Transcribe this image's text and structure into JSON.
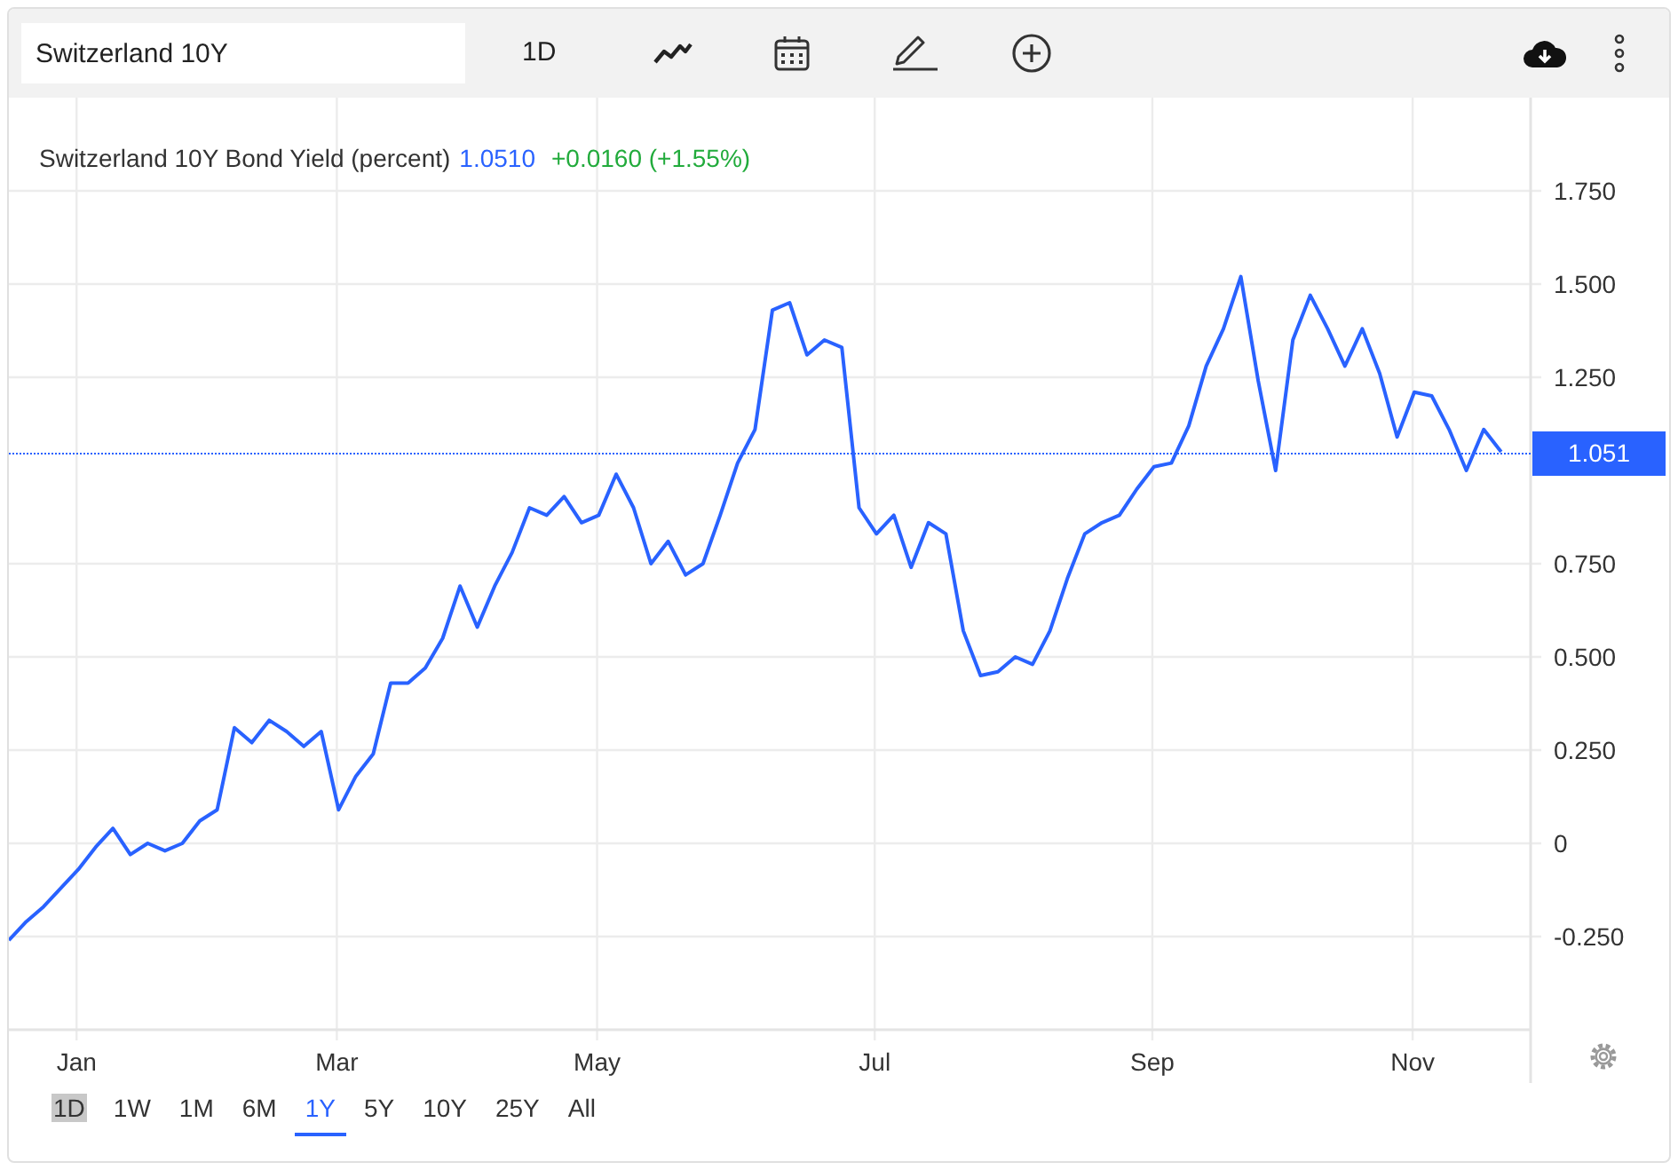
{
  "toolbar": {
    "search_value": "Switzerland 10Y",
    "interval": "1D"
  },
  "legend": {
    "title": "Switzerland 10Y Bond Yield (percent)",
    "value": "1.0510",
    "change": "+0.0160 (+1.55%)"
  },
  "chart_data": {
    "type": "line",
    "ylim": [
      -0.5,
      2.0
    ],
    "yticks": [
      {
        "value": -0.25,
        "label": "-0.250"
      },
      {
        "value": 0,
        "label": "0"
      },
      {
        "value": 0.25,
        "label": "0.250"
      },
      {
        "value": 0.5,
        "label": "0.500"
      },
      {
        "value": 0.75,
        "label": "0.750"
      },
      {
        "value": 1.25,
        "label": "1.250"
      },
      {
        "value": 1.5,
        "label": "1.500"
      },
      {
        "value": 1.75,
        "label": "1.750"
      }
    ],
    "categories": [
      null,
      null,
      null,
      null,
      "Jan",
      null,
      null,
      null,
      null,
      null,
      null,
      null,
      null,
      null,
      null,
      null,
      null,
      null,
      null,
      "Mar",
      null,
      null,
      null,
      null,
      null,
      null,
      null,
      null,
      null,
      null,
      null,
      null,
      null,
      null,
      "May",
      null,
      null,
      null,
      null,
      null,
      null,
      null,
      null,
      null,
      null,
      null,
      null,
      null,
      null,
      null,
      "Jul",
      null,
      null,
      null,
      null,
      null,
      null,
      null,
      null,
      null,
      null,
      null,
      null,
      null,
      null,
      null,
      "Sep",
      null,
      null,
      null,
      null,
      null,
      null,
      null,
      null,
      null,
      null,
      null,
      null,
      null,
      null,
      "Nov",
      null,
      null,
      null,
      null,
      null
    ],
    "series": [
      {
        "color": "#2962ff",
        "values": [
          -0.26,
          -0.21,
          -0.17,
          -0.12,
          -0.07,
          -0.01,
          0.04,
          -0.03,
          0.0,
          -0.02,
          0.0,
          0.06,
          0.09,
          0.31,
          0.27,
          0.33,
          0.3,
          0.26,
          0.3,
          0.09,
          0.18,
          0.24,
          0.43,
          0.43,
          0.47,
          0.55,
          0.69,
          0.58,
          0.69,
          0.78,
          0.9,
          0.88,
          0.93,
          0.86,
          0.88,
          0.99,
          0.9,
          0.75,
          0.81,
          0.72,
          0.75,
          0.88,
          1.02,
          1.11,
          1.43,
          1.45,
          1.31,
          1.35,
          1.33,
          0.9,
          0.83,
          0.88,
          0.74,
          0.86,
          0.83,
          0.57,
          0.45,
          0.46,
          0.5,
          0.48,
          0.57,
          0.71,
          0.83,
          0.86,
          0.88,
          0.95,
          1.01,
          1.02,
          1.12,
          1.28,
          1.38,
          1.52,
          1.24,
          1.0,
          1.35,
          1.47,
          1.38,
          1.28,
          1.38,
          1.26,
          1.09,
          1.21,
          1.2,
          1.11,
          1.0,
          1.11,
          1.05
        ]
      }
    ],
    "grid": true
  },
  "price_tag": "1.051",
  "ranges": [
    {
      "label": "1D",
      "selected": false,
      "highlighted": true
    },
    {
      "label": "1W",
      "selected": false,
      "highlighted": false
    },
    {
      "label": "1M",
      "selected": false,
      "highlighted": false
    },
    {
      "label": "6M",
      "selected": false,
      "highlighted": false
    },
    {
      "label": "1Y",
      "selected": true,
      "highlighted": false
    },
    {
      "label": "5Y",
      "selected": false,
      "highlighted": false
    },
    {
      "label": "10Y",
      "selected": false,
      "highlighted": false
    },
    {
      "label": "25Y",
      "selected": false,
      "highlighted": false
    },
    {
      "label": "All",
      "selected": false,
      "highlighted": false
    }
  ]
}
